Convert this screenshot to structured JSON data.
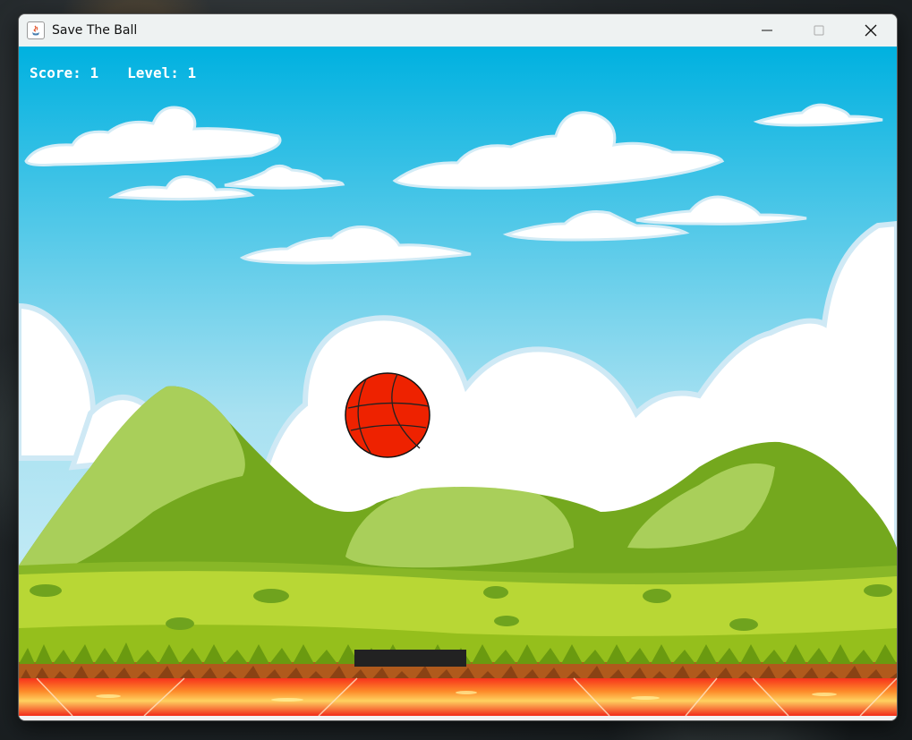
{
  "window": {
    "title": "Save The Ball",
    "controls": [
      "minimize",
      "maximize",
      "close"
    ]
  },
  "hud": {
    "score_label": "Score:",
    "score_value": "1",
    "level_label": "Level:",
    "level_value": "1"
  },
  "game": {
    "ball_color": "#ee2200",
    "paddle_color": "#222222",
    "sky_top": "#00b1e0",
    "sky_bottom": "#a8e1f1",
    "lava_color": "#f7331c"
  },
  "icons": [
    "java-app-icon",
    "minimize-icon",
    "maximize-icon",
    "close-icon"
  ]
}
